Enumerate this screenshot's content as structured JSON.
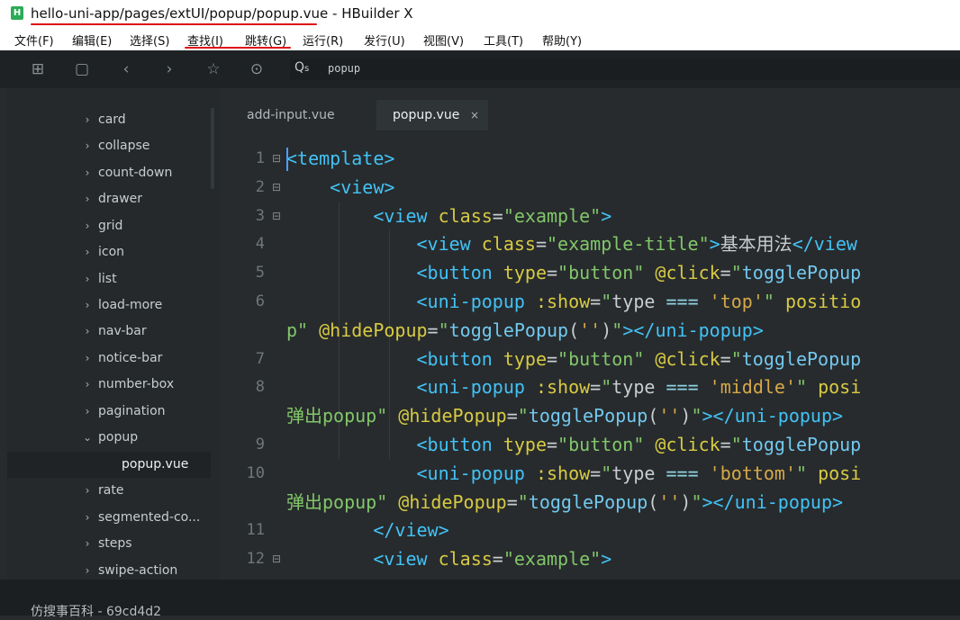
{
  "window": {
    "title": "hello-uni-app/pages/extUI/popup/popup.vue - HBuilder X",
    "app_icon_letter": "H",
    "accent": "#2bab56"
  },
  "menu": [
    {
      "label": "文件(F)"
    },
    {
      "label": "编辑(E)"
    },
    {
      "label": "选择(S)"
    },
    {
      "label": "查找(I)"
    },
    {
      "label": "跳转(G)"
    },
    {
      "label": "运行(R)"
    },
    {
      "label": "发行(U)"
    },
    {
      "label": "视图(V)"
    },
    {
      "label": "工具(T)"
    },
    {
      "label": "帮助(Y)"
    }
  ],
  "toolbar": {
    "icons": [
      "new-file-icon",
      "save-icon",
      "back-icon",
      "forward-icon",
      "star-icon",
      "run-icon"
    ],
    "search_icon_text": "Q",
    "search_hint": "s",
    "search_value": "popup"
  },
  "sidebar": {
    "items": [
      {
        "label": "card",
        "chevron": "›"
      },
      {
        "label": "collapse",
        "chevron": "›"
      },
      {
        "label": "count-down",
        "chevron": "›"
      },
      {
        "label": "drawer",
        "chevron": "›"
      },
      {
        "label": "grid",
        "chevron": "›"
      },
      {
        "label": "icon",
        "chevron": "›"
      },
      {
        "label": "list",
        "chevron": "›"
      },
      {
        "label": "load-more",
        "chevron": "›"
      },
      {
        "label": "nav-bar",
        "chevron": "›"
      },
      {
        "label": "notice-bar",
        "chevron": "›"
      },
      {
        "label": "number-box",
        "chevron": "›"
      },
      {
        "label": "pagination",
        "chevron": "›"
      },
      {
        "label": "popup",
        "chevron": "⌄"
      },
      {
        "label": "popup.vue",
        "chevron": ""
      },
      {
        "label": "rate",
        "chevron": "›"
      },
      {
        "label": "segmented-co...",
        "chevron": "›"
      },
      {
        "label": "steps",
        "chevron": "›"
      },
      {
        "label": "swipe-action",
        "chevron": "›"
      }
    ]
  },
  "tabs": [
    {
      "label": "add-input.vue"
    },
    {
      "label": "popup.vue",
      "close": "×"
    }
  ],
  "code": {
    "lines": [
      {
        "n": "1",
        "fold": "⊟",
        "segs": [
          {
            "c": "c-tag",
            "t": "<template>"
          }
        ]
      },
      {
        "n": "2",
        "fold": "⊟",
        "segs": [
          {
            "c": "c-plain",
            "t": "    "
          },
          {
            "c": "c-tag",
            "t": "<view>"
          }
        ]
      },
      {
        "n": "3",
        "fold": "⊟",
        "segs": [
          {
            "c": "c-plain",
            "t": "        "
          },
          {
            "c": "c-tag",
            "t": "<view "
          },
          {
            "c": "c-attr",
            "t": "class"
          },
          {
            "c": "c-plain",
            "t": "="
          },
          {
            "c": "c-val",
            "t": "\"example\""
          },
          {
            "c": "c-tag",
            "t": ">"
          }
        ]
      },
      {
        "n": "4",
        "fold": "",
        "segs": [
          {
            "c": "c-plain",
            "t": "            "
          },
          {
            "c": "c-tag",
            "t": "<view "
          },
          {
            "c": "c-attr",
            "t": "class"
          },
          {
            "c": "c-plain",
            "t": "="
          },
          {
            "c": "c-val",
            "t": "\"example-title\""
          },
          {
            "c": "c-tag",
            "t": ">"
          },
          {
            "c": "c-plain",
            "t": "基本用法"
          },
          {
            "c": "c-tag",
            "t": "</view"
          }
        ]
      },
      {
        "n": "5",
        "fold": "",
        "segs": [
          {
            "c": "c-plain",
            "t": "            "
          },
          {
            "c": "c-tag",
            "t": "<button "
          },
          {
            "c": "c-attr",
            "t": "type"
          },
          {
            "c": "c-plain",
            "t": "="
          },
          {
            "c": "c-val",
            "t": "\"button\" "
          },
          {
            "c": "c-attr",
            "t": "@click"
          },
          {
            "c": "c-plain",
            "t": "="
          },
          {
            "c": "c-val",
            "t": "\""
          },
          {
            "c": "c-fn",
            "t": "togglePopup"
          }
        ]
      },
      {
        "n": "6",
        "fold": "",
        "segs": [
          {
            "c": "c-plain",
            "t": "            "
          },
          {
            "c": "c-tag",
            "t": "<uni-popup "
          },
          {
            "c": "c-attr",
            "t": ":show"
          },
          {
            "c": "c-plain",
            "t": "="
          },
          {
            "c": "c-val",
            "t": "\""
          },
          {
            "c": "c-cn",
            "t": "type "
          },
          {
            "c": "c-op",
            "t": "==="
          },
          {
            "c": "c-plain",
            "t": " "
          },
          {
            "c": "c-lit",
            "t": "'top'"
          },
          {
            "c": "c-val",
            "t": "\" "
          },
          {
            "c": "c-attr",
            "t": "positio"
          }
        ]
      },
      {
        "n": "",
        "fold": "",
        "segs": [
          {
            "c": "c-val",
            "t": "p\" "
          },
          {
            "c": "c-attr",
            "t": "@hidePopup"
          },
          {
            "c": "c-plain",
            "t": "="
          },
          {
            "c": "c-val",
            "t": "\""
          },
          {
            "c": "c-fn",
            "t": "togglePopup"
          },
          {
            "c": "c-plain",
            "t": "("
          },
          {
            "c": "c-lit",
            "t": "''"
          },
          {
            "c": "c-plain",
            "t": ")"
          },
          {
            "c": "c-val",
            "t": "\""
          },
          {
            "c": "c-tag",
            "t": "></uni-popup>"
          }
        ]
      },
      {
        "n": "7",
        "fold": "",
        "segs": [
          {
            "c": "c-plain",
            "t": "            "
          },
          {
            "c": "c-tag",
            "t": "<button "
          },
          {
            "c": "c-attr",
            "t": "type"
          },
          {
            "c": "c-plain",
            "t": "="
          },
          {
            "c": "c-val",
            "t": "\"button\" "
          },
          {
            "c": "c-attr",
            "t": "@click"
          },
          {
            "c": "c-plain",
            "t": "="
          },
          {
            "c": "c-val",
            "t": "\""
          },
          {
            "c": "c-fn",
            "t": "togglePopup"
          }
        ]
      },
      {
        "n": "8",
        "fold": "",
        "segs": [
          {
            "c": "c-plain",
            "t": "            "
          },
          {
            "c": "c-tag",
            "t": "<uni-popup "
          },
          {
            "c": "c-attr",
            "t": ":show"
          },
          {
            "c": "c-plain",
            "t": "="
          },
          {
            "c": "c-val",
            "t": "\""
          },
          {
            "c": "c-cn",
            "t": "type "
          },
          {
            "c": "c-op",
            "t": "==="
          },
          {
            "c": "c-plain",
            "t": " "
          },
          {
            "c": "c-lit",
            "t": "'middle'"
          },
          {
            "c": "c-val",
            "t": "\" "
          },
          {
            "c": "c-attr",
            "t": "posi"
          }
        ]
      },
      {
        "n": "",
        "fold": "",
        "segs": [
          {
            "c": "c-val",
            "t": "弹出popup\" "
          },
          {
            "c": "c-attr",
            "t": "@hidePopup"
          },
          {
            "c": "c-plain",
            "t": "="
          },
          {
            "c": "c-val",
            "t": "\""
          },
          {
            "c": "c-fn",
            "t": "togglePopup"
          },
          {
            "c": "c-plain",
            "t": "("
          },
          {
            "c": "c-lit",
            "t": "''"
          },
          {
            "c": "c-plain",
            "t": ")"
          },
          {
            "c": "c-val",
            "t": "\""
          },
          {
            "c": "c-tag",
            "t": "></uni-popup>"
          }
        ]
      },
      {
        "n": "9",
        "fold": "",
        "segs": [
          {
            "c": "c-plain",
            "t": "            "
          },
          {
            "c": "c-tag",
            "t": "<button "
          },
          {
            "c": "c-attr",
            "t": "type"
          },
          {
            "c": "c-plain",
            "t": "="
          },
          {
            "c": "c-val",
            "t": "\"button\" "
          },
          {
            "c": "c-attr",
            "t": "@click"
          },
          {
            "c": "c-plain",
            "t": "="
          },
          {
            "c": "c-val",
            "t": "\""
          },
          {
            "c": "c-fn",
            "t": "togglePopup"
          }
        ]
      },
      {
        "n": "10",
        "fold": "",
        "segs": [
          {
            "c": "c-plain",
            "t": "            "
          },
          {
            "c": "c-tag",
            "t": "<uni-popup "
          },
          {
            "c": "c-attr",
            "t": ":show"
          },
          {
            "c": "c-plain",
            "t": "="
          },
          {
            "c": "c-val",
            "t": "\""
          },
          {
            "c": "c-cn",
            "t": "type "
          },
          {
            "c": "c-op",
            "t": "==="
          },
          {
            "c": "c-plain",
            "t": " "
          },
          {
            "c": "c-lit",
            "t": "'bottom'"
          },
          {
            "c": "c-val",
            "t": "\" "
          },
          {
            "c": "c-attr",
            "t": "posi"
          }
        ]
      },
      {
        "n": "",
        "fold": "",
        "segs": [
          {
            "c": "c-val",
            "t": "弹出popup\" "
          },
          {
            "c": "c-attr",
            "t": "@hidePopup"
          },
          {
            "c": "c-plain",
            "t": "="
          },
          {
            "c": "c-val",
            "t": "\""
          },
          {
            "c": "c-fn",
            "t": "togglePopup"
          },
          {
            "c": "c-plain",
            "t": "("
          },
          {
            "c": "c-lit",
            "t": "''"
          },
          {
            "c": "c-plain",
            "t": ")"
          },
          {
            "c": "c-val",
            "t": "\""
          },
          {
            "c": "c-tag",
            "t": "></uni-popup>"
          }
        ]
      },
      {
        "n": "11",
        "fold": "",
        "segs": [
          {
            "c": "c-plain",
            "t": "        "
          },
          {
            "c": "c-tag",
            "t": "</view>"
          }
        ]
      },
      {
        "n": "12",
        "fold": "⊟",
        "segs": [
          {
            "c": "c-plain",
            "t": "        "
          },
          {
            "c": "c-tag",
            "t": "<view "
          },
          {
            "c": "c-attr",
            "t": "class"
          },
          {
            "c": "c-plain",
            "t": "="
          },
          {
            "c": "c-val",
            "t": "\"example\""
          },
          {
            "c": "c-tag",
            "t": ">"
          }
        ]
      }
    ]
  },
  "status": {
    "text": "仿搜事百科 - 69cd4d2"
  }
}
